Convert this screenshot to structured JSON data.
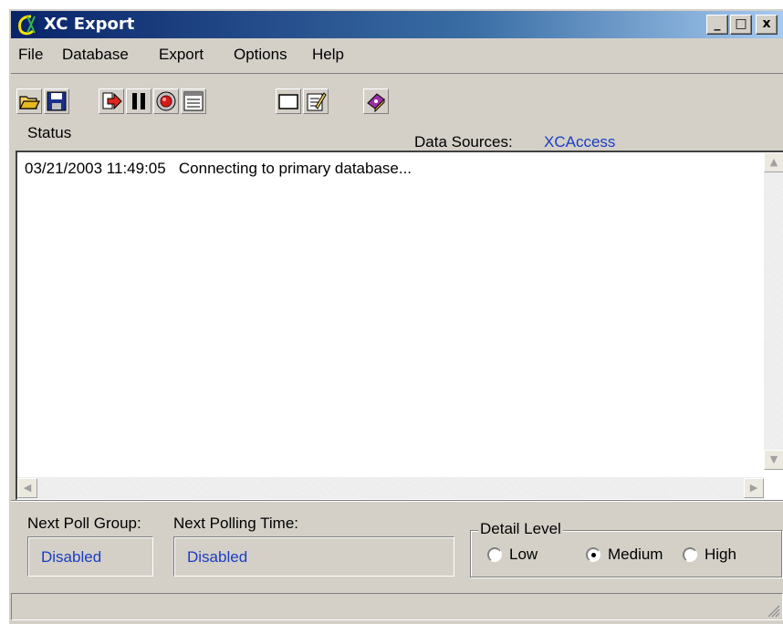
{
  "window": {
    "title": "XC Export",
    "controls": {
      "minimize": "_",
      "maximize": "□",
      "close": "x"
    }
  },
  "menu": [
    "File",
    "Database",
    "Export",
    "Options",
    "Help"
  ],
  "toolbar": [
    {
      "icon": "open-folder-icon"
    },
    {
      "icon": "save-disk-icon"
    },
    {
      "icon": "export-arrow-icon"
    },
    {
      "icon": "pause-icon"
    },
    {
      "icon": "stop-record-icon"
    },
    {
      "icon": "list-view-icon"
    },
    {
      "icon": "blank-window-icon"
    },
    {
      "icon": "edit-notepad-icon"
    },
    {
      "icon": "help-book-icon"
    }
  ],
  "status": {
    "label": "Status",
    "data_sources_label": "Data Sources:",
    "data_sources_value": "XCAccess"
  },
  "log": {
    "lines": [
      {
        "timestamp": "03/21/2003 11:49:05",
        "message": "Connecting to primary database..."
      }
    ]
  },
  "bottom": {
    "next_poll_group_label": "Next Poll Group:",
    "next_poll_group_value": "Disabled",
    "next_polling_time_label": "Next Polling Time:",
    "next_polling_time_value": "Disabled",
    "detail_level": {
      "label": "Detail Level",
      "options": [
        "Low",
        "Medium",
        "High"
      ],
      "selected": "Medium"
    }
  },
  "colors": {
    "window_face": "#d4d0c8",
    "title_gradient_start": "#0a246a",
    "title_gradient_end": "#a6caf0",
    "value_text": "#1a3dc2"
  }
}
